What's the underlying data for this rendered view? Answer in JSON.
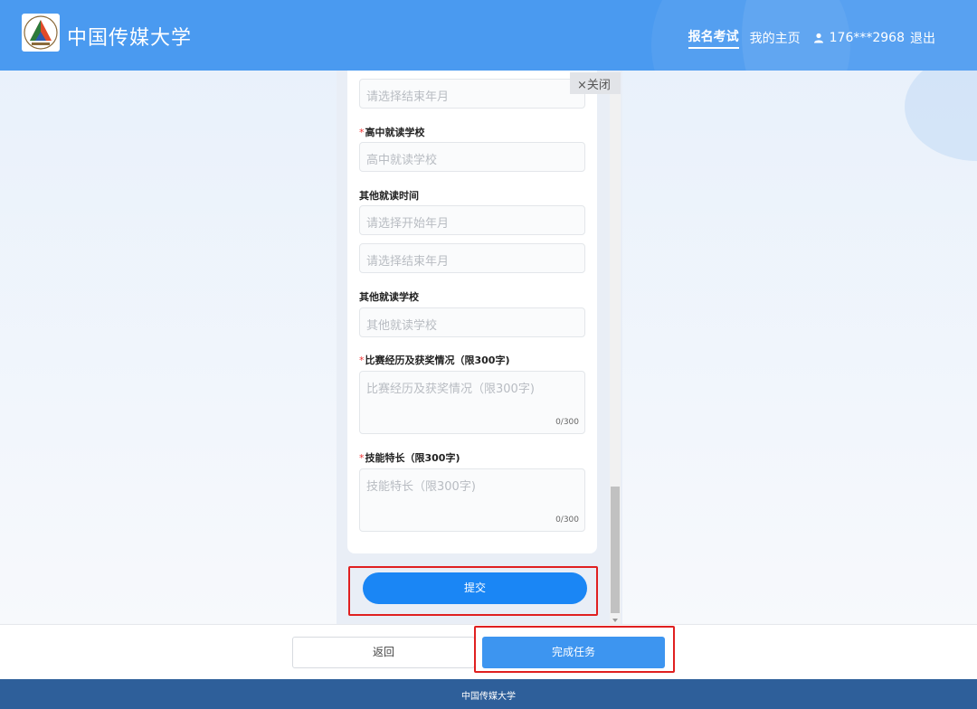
{
  "header": {
    "brand": "中国传媒大学",
    "nav_active": "报名考试",
    "nav_home": "我的主页",
    "user": "176***2968",
    "logout": "退出",
    "accent": "#4a9af0"
  },
  "dialog": {
    "close_label": "×关闭"
  },
  "form": {
    "end_date_1_placeholder": "请选择结束年月",
    "high_school_label": "高中就读学校",
    "high_school_placeholder": "高中就读学校",
    "other_time_label": "其他就读时间",
    "other_start_placeholder": "请选择开始年月",
    "other_end_placeholder": "请选择结束年月",
    "other_school_label": "其他就读学校",
    "other_school_placeholder": "其他就读学校",
    "competition_label": "比赛经历及获奖情况（限300字)",
    "competition_placeholder": "比赛经历及获奖情况（限300字)",
    "competition_counter": "0/300",
    "skills_label": "技能特长（限300字)",
    "skills_placeholder": "技能特长（限300字)",
    "skills_counter": "0/300",
    "required_mark": "*",
    "submit_label": "提交"
  },
  "bottom": {
    "back_label": "返回",
    "done_label": "完成任务"
  },
  "footer": {
    "text": "中国传媒大学"
  }
}
